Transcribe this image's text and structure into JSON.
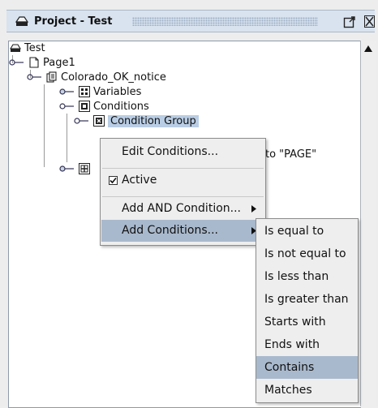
{
  "panel": {
    "title": "Project - Test"
  },
  "tree": {
    "root": "Test",
    "page": "Page1",
    "notice": "Colorado_OK_notice",
    "variables": "Variables",
    "conditions": "Conditions",
    "condition_group": "Condition Group",
    "partial_text": "to \"PAGE\""
  },
  "context_menu": {
    "edit_conditions": "Edit Conditions...",
    "active": "Active",
    "add_and_condition": "Add AND Condition...",
    "add_conditions": "Add Conditions..."
  },
  "submenu": {
    "items": [
      "Is equal to",
      "Is not equal to",
      "Is less than",
      "Is greater than",
      "Starts with",
      "Ends with",
      "Contains",
      "Matches"
    ],
    "highlighted": "Contains"
  },
  "colors": {
    "highlight": "#a9b9cd",
    "tree_selection": "#b9cde4",
    "title_bar": "#d9e3ef"
  }
}
